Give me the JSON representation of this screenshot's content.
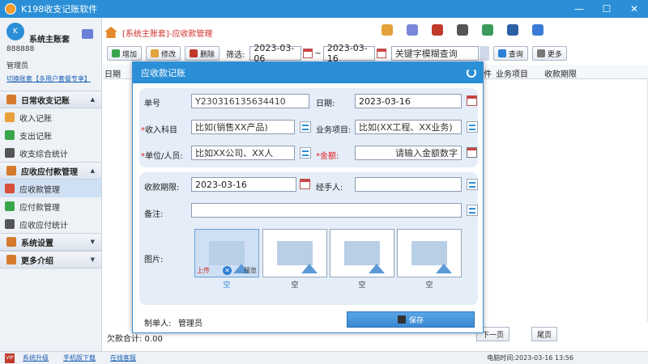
{
  "app": {
    "title": "K198收支记账软件"
  },
  "sidebar": {
    "account_name": "系统主账套",
    "account_id": "888888",
    "role": "管理员",
    "switch_link": "切换账套【多用户套餐专享】",
    "sections": [
      {
        "label": "日常收支记账",
        "items": [
          "收入记账",
          "支出记账",
          "收支综合统计"
        ]
      },
      {
        "label": "应收应付款管理",
        "items": [
          "应收款管理",
          "应付款管理",
          "应收应付统计"
        ]
      },
      {
        "label": "系统设置",
        "items": []
      },
      {
        "label": "更多介绍",
        "items": []
      }
    ]
  },
  "header": {
    "breadcrumb": "[系统主账套]-应收款管理"
  },
  "toolbar": {
    "add": "增加",
    "edit": "修改",
    "delete": "删除",
    "filter_label": "筛选:",
    "date_from": "2023-03-06",
    "tilde": "~",
    "date_to": "2023-03-16",
    "search_placeholder": "关键字模糊查询",
    "query": "查询",
    "more": "更多"
  },
  "grid": {
    "columns": [
      "日期",
      "业务项目",
      "收款期限"
    ],
    "partial_col": "件"
  },
  "footer": {
    "summary": "欠款合计: 0.00",
    "next": "下一页",
    "last": "尾页"
  },
  "statusbar": {
    "upgrade": "系统升级",
    "mobile": "手机版下载",
    "support": "在线客服",
    "clock": "电脑时间:2023-03-16 13:56"
  },
  "dialog": {
    "title": "应收款记账",
    "doc_no_label": "单号",
    "doc_no": "Y230316135634410",
    "date_label": "日期:",
    "date": "2023-03-16",
    "income_label": "收入科目",
    "income_value": "比如(销售XX产品)",
    "project_label": "业务项目:",
    "project_value": "比如(XX工程、XX业务)",
    "unit_label": "单位/人员:",
    "unit_value": "比如XX公司、XX人",
    "amount_label": "金额:",
    "amount_placeholder": "请输入金额数字",
    "deadline_label": "收款期限:",
    "deadline": "2023-03-16",
    "handler_label": "经手人:",
    "remark_label": "备注:",
    "images_label": "图片:",
    "upload": "上传",
    "preview": "预览",
    "image_captions": [
      "空",
      "空",
      "空",
      "空"
    ],
    "creator_label": "制单人:",
    "creator": "管理员",
    "save": "保存"
  }
}
